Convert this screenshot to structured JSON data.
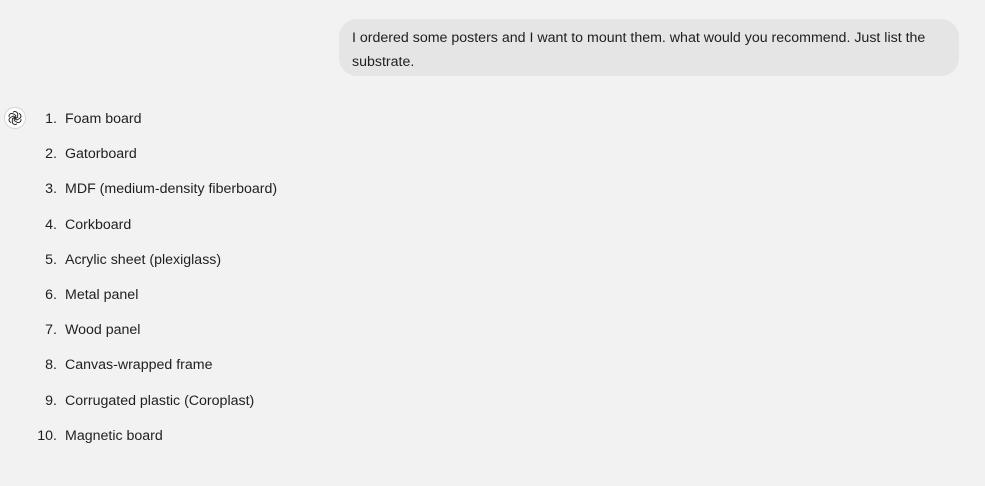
{
  "conversation": {
    "user_message": "I ordered some posters and I want to mount them. what would you recommend. Just list the substrate.",
    "assistant": {
      "avatar_icon": "openai-logo-icon",
      "items": [
        {
          "number": "1.",
          "text": "Foam board"
        },
        {
          "number": "2.",
          "text": "Gatorboard"
        },
        {
          "number": "3.",
          "text": "MDF (medium-density fiberboard)"
        },
        {
          "number": "4.",
          "text": "Corkboard"
        },
        {
          "number": "5.",
          "text": "Acrylic sheet (plexiglass)"
        },
        {
          "number": "6.",
          "text": "Metal panel"
        },
        {
          "number": "7.",
          "text": "Wood panel"
        },
        {
          "number": "8.",
          "text": "Canvas-wrapped frame"
        },
        {
          "number": "9.",
          "text": "Corrugated plastic (Coroplast)"
        },
        {
          "number": "10.",
          "text": "Magnetic board"
        }
      ]
    }
  },
  "colors": {
    "page_background": "#f1f2f1",
    "user_bubble_background": "#e4e5e4",
    "text": "#1f1f1f"
  }
}
